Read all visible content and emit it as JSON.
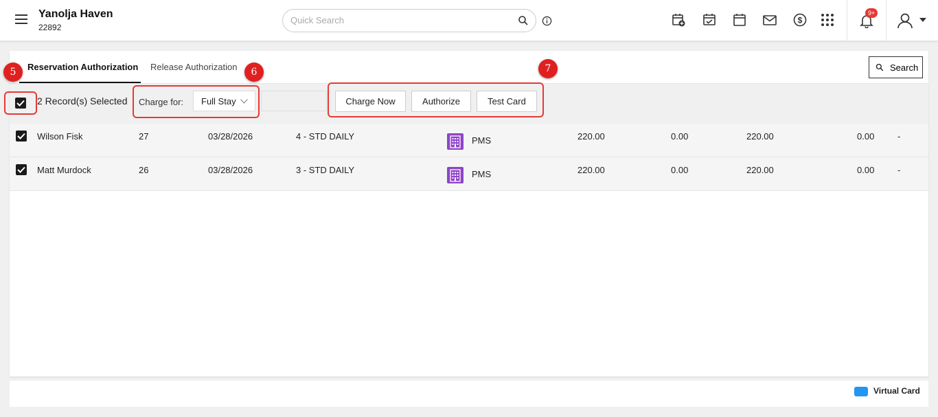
{
  "header": {
    "property_name": "Yanolja Haven",
    "property_code": "22892",
    "search_placeholder": "Quick Search",
    "notification_badge": "9+"
  },
  "tabs": [
    {
      "label": "Reservation Authorization",
      "active": true
    },
    {
      "label": "Release Authorization",
      "active": false
    }
  ],
  "search_button": "Search",
  "toolbar": {
    "records_selected": "2 Record(s) Selected",
    "charge_for_label": "Charge for:",
    "charge_for_value": "Full Stay",
    "buttons": {
      "charge_now": "Charge Now",
      "authorize": "Authorize",
      "test_card": "Test Card"
    }
  },
  "rows": [
    {
      "name": "Wilson Fisk",
      "room": "27",
      "date": "03/28/2026",
      "rate": "4 - STD DAILY",
      "source": "PMS",
      "amount1": "220.00",
      "amount2": "0.00",
      "amount3": "220.00",
      "amount4": "0.00",
      "extra": "-",
      "checked": true
    },
    {
      "name": "Matt Murdock",
      "room": "26",
      "date": "03/28/2026",
      "rate": "3 - STD DAILY",
      "source": "PMS",
      "amount1": "220.00",
      "amount2": "0.00",
      "amount3": "220.00",
      "amount4": "0.00",
      "extra": "-",
      "checked": true
    }
  ],
  "legend": {
    "virtual_card": "Virtual Card",
    "virtual_card_color": "#2196f3"
  },
  "annotations": [
    "5",
    "6",
    "7"
  ]
}
